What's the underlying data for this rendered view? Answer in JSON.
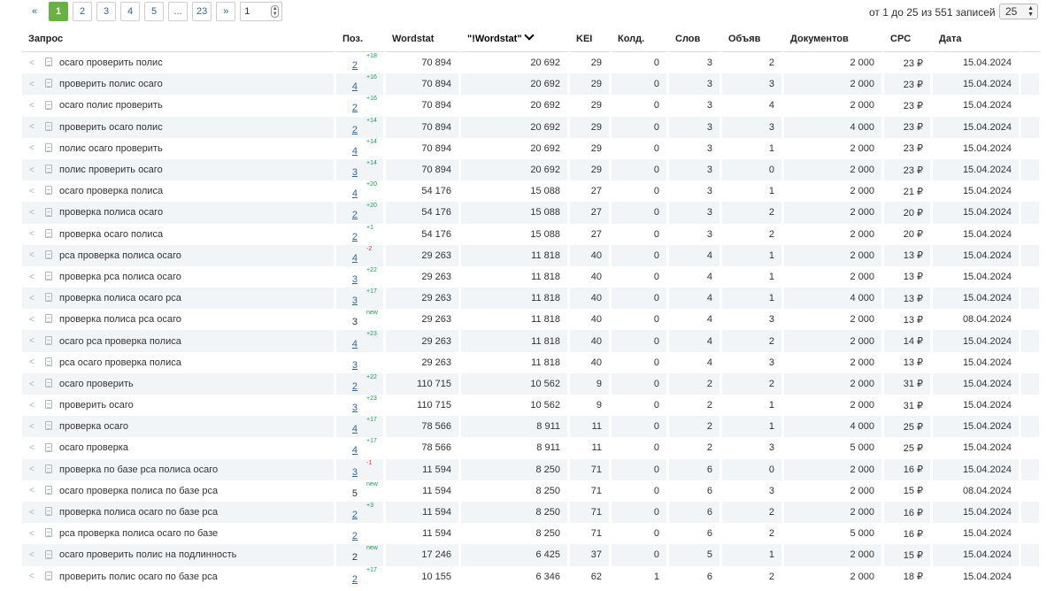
{
  "pagination": {
    "prev": "«",
    "pages": [
      "1",
      "2",
      "3",
      "4",
      "5",
      "...",
      "23"
    ],
    "active_page": "1",
    "next": "»",
    "goto_value": "1"
  },
  "records_text": "от 1 до 25 из 551 записей",
  "per_page": "25",
  "columns": {
    "query": "Запрос",
    "pos": "Поз.",
    "wordstat": "Wordstat",
    "wordstat_exact": "\"!Wordstat\"",
    "kei": "KEI",
    "kold": "Колд.",
    "slov": "Слов",
    "obyav": "Объяв",
    "docs": "Документов",
    "cpc": "CPC",
    "date": "Дата"
  },
  "rows": [
    {
      "q": "осаго проверить полис",
      "pos": "2",
      "pos_link": true,
      "chg": "+18",
      "dir": "up",
      "ws": "70 894",
      "wse": "20 692",
      "kei": "29",
      "kold": "0",
      "slov": "3",
      "obyav": "2",
      "docs": "2 000",
      "cpc": "23 ₽",
      "date": "15.04.2024"
    },
    {
      "q": "проверить полис осаго",
      "pos": "4",
      "pos_link": true,
      "chg": "+16",
      "dir": "up",
      "ws": "70 894",
      "wse": "20 692",
      "kei": "29",
      "kold": "0",
      "slov": "3",
      "obyav": "3",
      "docs": "2 000",
      "cpc": "23 ₽",
      "date": "15.04.2024"
    },
    {
      "q": "осаго полис проверить",
      "pos": "2",
      "pos_link": true,
      "chg": "+16",
      "dir": "up",
      "ws": "70 894",
      "wse": "20 692",
      "kei": "29",
      "kold": "0",
      "slov": "3",
      "obyav": "4",
      "docs": "2 000",
      "cpc": "23 ₽",
      "date": "15.04.2024"
    },
    {
      "q": "проверить осаго полис",
      "pos": "2",
      "pos_link": true,
      "chg": "+14",
      "dir": "up",
      "ws": "70 894",
      "wse": "20 692",
      "kei": "29",
      "kold": "0",
      "slov": "3",
      "obyav": "3",
      "docs": "4 000",
      "cpc": "23 ₽",
      "date": "15.04.2024"
    },
    {
      "q": "полис осаго проверить",
      "pos": "4",
      "pos_link": true,
      "chg": "+14",
      "dir": "up",
      "ws": "70 894",
      "wse": "20 692",
      "kei": "29",
      "kold": "0",
      "slov": "3",
      "obyav": "1",
      "docs": "2 000",
      "cpc": "23 ₽",
      "date": "15.04.2024"
    },
    {
      "q": "полис проверить осаго",
      "pos": "3",
      "pos_link": true,
      "chg": "+14",
      "dir": "up",
      "ws": "70 894",
      "wse": "20 692",
      "kei": "29",
      "kold": "0",
      "slov": "3",
      "obyav": "0",
      "docs": "2 000",
      "cpc": "23 ₽",
      "date": "15.04.2024"
    },
    {
      "q": "осаго проверка полиса",
      "pos": "4",
      "pos_link": true,
      "chg": "+20",
      "dir": "up",
      "ws": "54 176",
      "wse": "15 088",
      "kei": "27",
      "kold": "0",
      "slov": "3",
      "obyav": "1",
      "docs": "2 000",
      "cpc": "21 ₽",
      "date": "15.04.2024"
    },
    {
      "q": "проверка полиса осаго",
      "pos": "2",
      "pos_link": true,
      "chg": "+20",
      "dir": "up",
      "ws": "54 176",
      "wse": "15 088",
      "kei": "27",
      "kold": "0",
      "slov": "3",
      "obyav": "2",
      "docs": "2 000",
      "cpc": "20 ₽",
      "date": "15.04.2024"
    },
    {
      "q": "проверка осаго полиса",
      "pos": "2",
      "pos_link": true,
      "chg": "+1",
      "dir": "up",
      "ws": "54 176",
      "wse": "15 088",
      "kei": "27",
      "kold": "0",
      "slov": "3",
      "obyav": "2",
      "docs": "2 000",
      "cpc": "20 ₽",
      "date": "15.04.2024"
    },
    {
      "q": "рса проверка полиса осаго",
      "pos": "4",
      "pos_link": true,
      "chg": "-2",
      "dir": "down",
      "ws": "29 263",
      "wse": "11 818",
      "kei": "40",
      "kold": "0",
      "slov": "4",
      "obyav": "1",
      "docs": "2 000",
      "cpc": "13 ₽",
      "date": "15.04.2024"
    },
    {
      "q": "проверка рса полиса осаго",
      "pos": "3",
      "pos_link": true,
      "chg": "+22",
      "dir": "up",
      "ws": "29 263",
      "wse": "11 818",
      "kei": "40",
      "kold": "0",
      "slov": "4",
      "obyav": "1",
      "docs": "2 000",
      "cpc": "13 ₽",
      "date": "15.04.2024"
    },
    {
      "q": "проверка полиса осаго рса",
      "pos": "3",
      "pos_link": true,
      "chg": "+17",
      "dir": "up",
      "ws": "29 263",
      "wse": "11 818",
      "kei": "40",
      "kold": "0",
      "slov": "4",
      "obyav": "1",
      "docs": "4 000",
      "cpc": "13 ₽",
      "date": "15.04.2024"
    },
    {
      "q": "проверка полиса рса осаго",
      "pos": "3",
      "pos_link": false,
      "chg": "new",
      "dir": "new",
      "ws": "29 263",
      "wse": "11 818",
      "kei": "40",
      "kold": "0",
      "slov": "4",
      "obyav": "3",
      "docs": "2 000",
      "cpc": "13 ₽",
      "date": "08.04.2024"
    },
    {
      "q": "осаго рса проверка полиса",
      "pos": "4",
      "pos_link": true,
      "chg": "+23",
      "dir": "up",
      "ws": "29 263",
      "wse": "11 818",
      "kei": "40",
      "kold": "0",
      "slov": "4",
      "obyav": "2",
      "docs": "2 000",
      "cpc": "14 ₽",
      "date": "15.04.2024"
    },
    {
      "q": "рса осаго проверка полиса",
      "pos": "3",
      "pos_link": true,
      "chg": "",
      "dir": "",
      "ws": "29 263",
      "wse": "11 818",
      "kei": "40",
      "kold": "0",
      "slov": "4",
      "obyav": "3",
      "docs": "2 000",
      "cpc": "13 ₽",
      "date": "15.04.2024"
    },
    {
      "q": "осаго проверить",
      "pos": "2",
      "pos_link": true,
      "chg": "+22",
      "dir": "up",
      "ws": "110 715",
      "wse": "10 562",
      "kei": "9",
      "kold": "0",
      "slov": "2",
      "obyav": "2",
      "docs": "2 000",
      "cpc": "31 ₽",
      "date": "15.04.2024"
    },
    {
      "q": "проверить осаго",
      "pos": "3",
      "pos_link": true,
      "chg": "+23",
      "dir": "up",
      "ws": "110 715",
      "wse": "10 562",
      "kei": "9",
      "kold": "0",
      "slov": "2",
      "obyav": "1",
      "docs": "2 000",
      "cpc": "31 ₽",
      "date": "15.04.2024"
    },
    {
      "q": "проверка осаго",
      "pos": "4",
      "pos_link": true,
      "chg": "+17",
      "dir": "up",
      "ws": "78 566",
      "wse": "8 911",
      "kei": "11",
      "kold": "0",
      "slov": "2",
      "obyav": "1",
      "docs": "4 000",
      "cpc": "25 ₽",
      "date": "15.04.2024"
    },
    {
      "q": "осаго проверка",
      "pos": "4",
      "pos_link": true,
      "chg": "+17",
      "dir": "up",
      "ws": "78 566",
      "wse": "8 911",
      "kei": "11",
      "kold": "0",
      "slov": "2",
      "obyav": "3",
      "docs": "5 000",
      "cpc": "25 ₽",
      "date": "15.04.2024"
    },
    {
      "q": "проверка по базе рса полиса осаго",
      "pos": "3",
      "pos_link": true,
      "chg": "-1",
      "dir": "down",
      "ws": "11 594",
      "wse": "8 250",
      "kei": "71",
      "kold": "0",
      "slov": "6",
      "obyav": "0",
      "docs": "2 000",
      "cpc": "16 ₽",
      "date": "15.04.2024"
    },
    {
      "q": "осаго проверка полиса по базе рса",
      "pos": "5",
      "pos_link": false,
      "chg": "new",
      "dir": "new",
      "ws": "11 594",
      "wse": "8 250",
      "kei": "71",
      "kold": "0",
      "slov": "6",
      "obyav": "3",
      "docs": "2 000",
      "cpc": "15 ₽",
      "date": "08.04.2024"
    },
    {
      "q": "проверка полиса осаго по базе рса",
      "pos": "2",
      "pos_link": true,
      "chg": "+3",
      "dir": "up",
      "ws": "11 594",
      "wse": "8 250",
      "kei": "71",
      "kold": "0",
      "slov": "6",
      "obyav": "2",
      "docs": "2 000",
      "cpc": "16 ₽",
      "date": "15.04.2024"
    },
    {
      "q": "рса проверка полиса осаго по базе",
      "pos": "2",
      "pos_link": true,
      "chg": "",
      "dir": "",
      "ws": "11 594",
      "wse": "8 250",
      "kei": "71",
      "kold": "0",
      "slov": "6",
      "obyav": "2",
      "docs": "5 000",
      "cpc": "16 ₽",
      "date": "15.04.2024"
    },
    {
      "q": "осаго проверить полис на подлинность",
      "pos": "2",
      "pos_link": false,
      "chg": "new",
      "dir": "new",
      "ws": "17 246",
      "wse": "6 425",
      "kei": "37",
      "kold": "0",
      "slov": "5",
      "obyav": "1",
      "docs": "2 000",
      "cpc": "15 ₽",
      "date": "15.04.2024"
    },
    {
      "q": "проверить полис осаго по базе рса",
      "pos": "2",
      "pos_link": true,
      "chg": "+17",
      "dir": "up",
      "ws": "10 155",
      "wse": "6 346",
      "kei": "62",
      "kold": "1",
      "slov": "6",
      "obyav": "2",
      "docs": "2 000",
      "cpc": "18 ₽",
      "date": "15.04.2024"
    }
  ]
}
